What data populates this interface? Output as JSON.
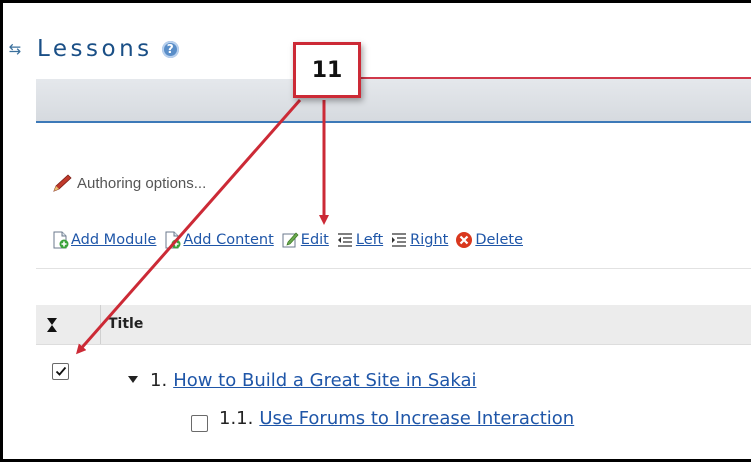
{
  "tool": {
    "title": "Lessons",
    "help_icon": "help-icon",
    "reset_icon": "reset-icon"
  },
  "callout": {
    "number": "11"
  },
  "authoring": {
    "label": "Authoring options...",
    "icon": "pencil-icon"
  },
  "toolbar": {
    "items": [
      {
        "label": "Add Module",
        "icon": "add-module-icon"
      },
      {
        "label": "Add Content",
        "icon": "add-content-icon"
      },
      {
        "label": "Edit",
        "icon": "edit-icon"
      },
      {
        "label": "Left",
        "icon": "outdent-icon"
      },
      {
        "label": "Right",
        "icon": "indent-icon"
      },
      {
        "label": "Delete",
        "icon": "delete-icon"
      }
    ]
  },
  "table": {
    "header_title": "Title",
    "rows": [
      {
        "number": "1.",
        "title": "How to Build a Great Site in Sakai",
        "checked": true
      },
      {
        "number": "1.1.",
        "title": "Use Forums to Increase Interaction",
        "checked": false
      }
    ]
  },
  "colors": {
    "accent_red": "#cc2a36",
    "link_blue": "#1f56a8",
    "title_blue": "#1a4f86"
  }
}
